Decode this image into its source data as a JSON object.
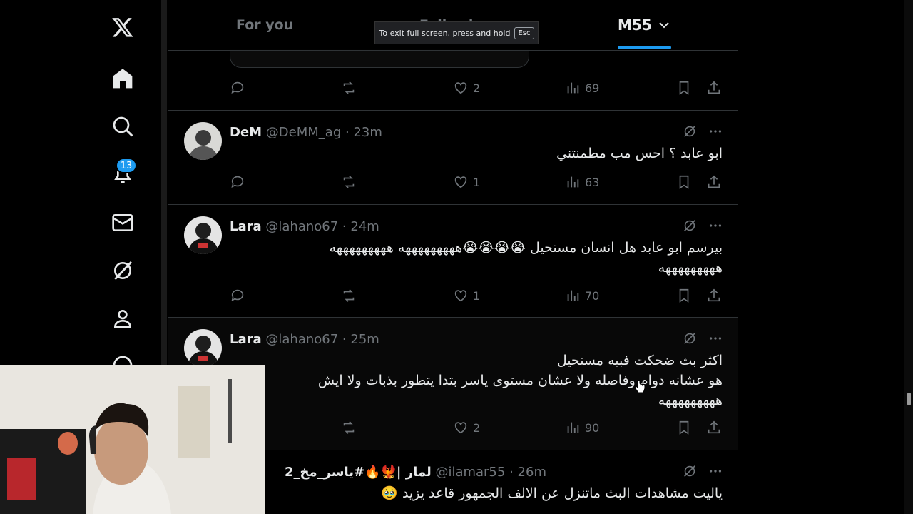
{
  "tabs": {
    "for_you": "For you",
    "following": "Following",
    "selected": "M55"
  },
  "fullscreen_toast": {
    "message": "To exit full screen, press and hold",
    "key": "Esc"
  },
  "sidebar": {
    "notifications_count": "13"
  },
  "posts": [
    {
      "stats": {
        "likes": "2",
        "views": "69"
      }
    },
    {
      "name": "DeM",
      "handle": "@DeMM_ag",
      "time": "23m",
      "lines": [
        "ابو عابد ؟ احس مب مطمنتني"
      ],
      "stats": {
        "likes": "1",
        "views": "63"
      }
    },
    {
      "name": "Lara",
      "handle": "@lahano67",
      "time": "24m",
      "lines": [
        "بيرسم ابو عابد هل انسان مستحيل 😭😭😭😭هههههههههه هههههههههه",
        "هههههههههه"
      ],
      "stats": {
        "likes": "1",
        "views": "70"
      }
    },
    {
      "name": "Lara",
      "handle": "@lahano67",
      "time": "25m",
      "lines": [
        "اكثر بث ضحكت فبيه مستحيل",
        "هو عشانه دوام وفاصله ولا عشان مستوى ياسر بتدا يتطور بذبات ولا ايش",
        "هههههههههه"
      ],
      "stats": {
        "likes": "2",
        "views": "90"
      }
    },
    {
      "name": "لمار |🐦‍🔥🔥#ياسر_مخ_2",
      "handle": "@ilamar55",
      "time": "26m",
      "lines": [
        "ياليت مشاهدات البث ماتنزل عن الالف الجمهور قاعد يزيد 🥹"
      ]
    }
  ],
  "colors": {
    "accent": "#1d9bf0",
    "background": "#000000",
    "muted": "#71767b",
    "text": "#e7e9ea"
  }
}
